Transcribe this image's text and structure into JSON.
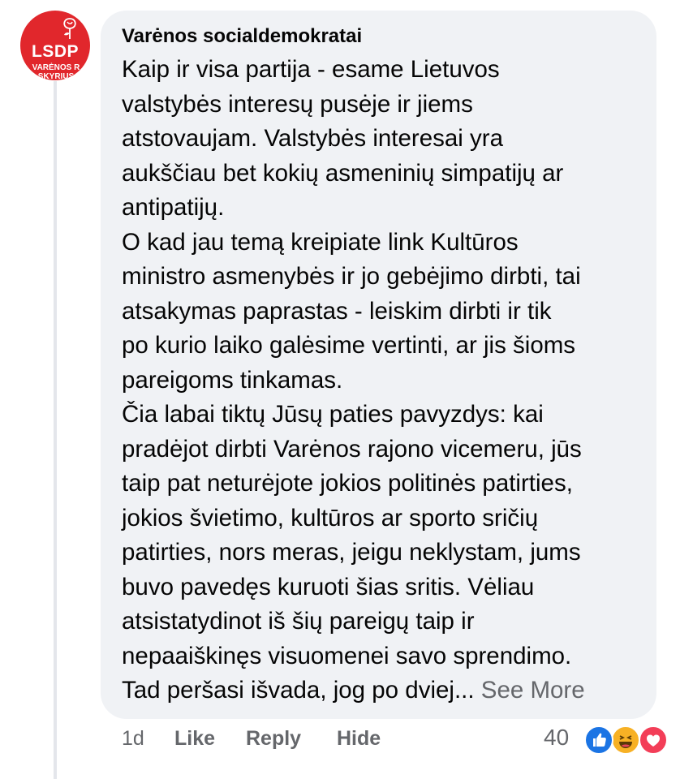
{
  "comment": {
    "author": "Varėnos socialdemokratai",
    "avatar": {
      "title": "LSDP",
      "subtitle_line1": "VARĖNOS R",
      "subtitle_line2": "SKYRIUS",
      "color": "#e1272c"
    },
    "lines": [
      "Kaip ir visa partija - esame Lietuvos",
      "valstybės interesų pusėje ir jiems",
      "atstovaujam. Valstybės interesai yra",
      "aukščiau bet kokių asmeninių simpatijų ar",
      "antipatijų.",
      "O kad jau temą kreipiate link Kultūros",
      "ministro asmenybės ir jo gebėjimo dirbti, tai",
      "atsakymas paprastas - leiskim dirbti ir tik",
      "po kurio laiko galėsime vertinti, ar jis šioms",
      "pareigoms tinkamas.",
      "Čia labai tiktų Jūsų paties pavyzdys: kai",
      "pradėjot dirbti Varėnos rajono vicemeru, jūs",
      "taip pat neturėjote jokios politinės patirties,",
      "jokios švietimo, kultūros ar sporto sričių",
      "patirties, nors meras, jeigu neklystam, jums",
      "buvo pavedęs kuruoti šias sritis. Vėliau",
      "atsistatydinot iš šių pareigų taip ir",
      "nepaaiškinęs visuomenei savo sprendimo.",
      "Tad peršasi išvada, jog po dviej..."
    ],
    "see_more": "See More",
    "actions": {
      "time": "1d",
      "like": "Like",
      "reply": "Reply",
      "hide": "Hide"
    },
    "reactions": {
      "count": "40",
      "icons": [
        "like-icon",
        "haha-icon",
        "love-icon"
      ],
      "colors": {
        "like": "#1b74e4",
        "haha": "#f7b125",
        "love": "#f33e58"
      }
    },
    "colors": {
      "bubble": "#f0f2f5",
      "secondary_text": "#65676b",
      "primary_text": "#050505"
    }
  }
}
